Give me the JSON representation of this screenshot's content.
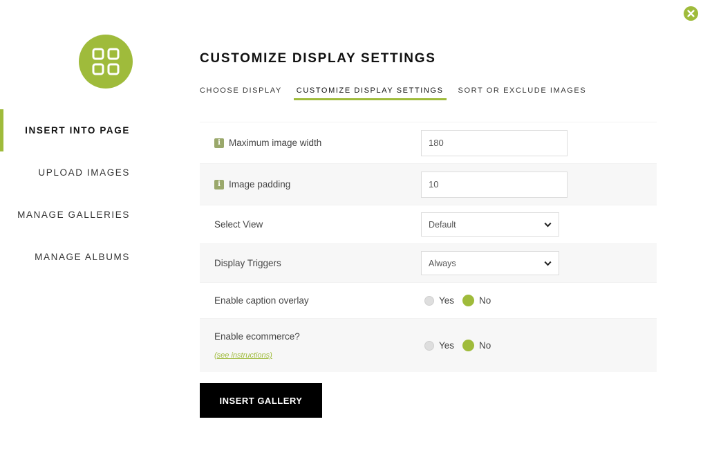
{
  "title": "CUSTOMIZE DISPLAY SETTINGS",
  "colors": {
    "accent": "#9fbb3b",
    "button": "#000000"
  },
  "sidebar": {
    "items": [
      {
        "label": "INSERT INTO PAGE",
        "active": true
      },
      {
        "label": "UPLOAD IMAGES"
      },
      {
        "label": "MANAGE GALLERIES"
      },
      {
        "label": "MANAGE ALBUMS"
      }
    ]
  },
  "tabs": [
    {
      "label": "CHOOSE DISPLAY"
    },
    {
      "label": "CUSTOMIZE DISPLAY SETTINGS",
      "active": true
    },
    {
      "label": "SORT OR EXCLUDE IMAGES"
    }
  ],
  "settings": {
    "max_width": {
      "label": "Maximum image width",
      "value": "180"
    },
    "padding": {
      "label": "Image padding",
      "value": "10"
    },
    "view": {
      "label": "Select View",
      "value": "Default"
    },
    "triggers": {
      "label": "Display Triggers",
      "value": "Always"
    },
    "caption": {
      "label": "Enable caption overlay",
      "yes": "Yes",
      "no": "No",
      "selected": "No"
    },
    "ecommerce": {
      "label": "Enable ecommerce?",
      "link": "(see instructions)",
      "yes": "Yes",
      "no": "No",
      "selected": "No"
    }
  },
  "insert_button": "INSERT GALLERY",
  "icons": {
    "close": "close-icon",
    "logo": "grid-icon",
    "info": "info-icon",
    "dropdown": "chevron-down-icon"
  }
}
